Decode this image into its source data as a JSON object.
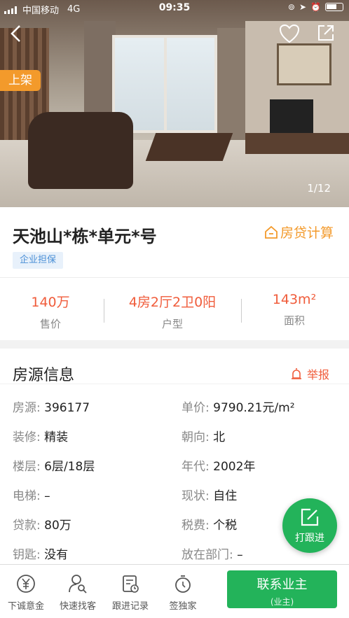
{
  "status_bar": {
    "carrier": "中国移动",
    "network": "4G",
    "time": "09:35"
  },
  "hero": {
    "listing_tag": "上架",
    "photo_counter": "1/12"
  },
  "title": {
    "name": "天池山*栋*单元*号",
    "mortgage_label": "房贷计算",
    "badge": "企业担保"
  },
  "stats": [
    {
      "value": "140万",
      "label": "售价"
    },
    {
      "value": "4房2厅2卫0阳",
      "label": "户型"
    },
    {
      "value": "143m²",
      "label": "面积"
    }
  ],
  "info": {
    "section_title": "房源信息",
    "report_label": "举报",
    "rows": [
      {
        "key": "房源:",
        "value": "396177"
      },
      {
        "key": "单价:",
        "value": "9790.21元/m²"
      },
      {
        "key": "装修:",
        "value": "精装"
      },
      {
        "key": "朝向:",
        "value": "北"
      },
      {
        "key": "楼层:",
        "value": "6层/18层"
      },
      {
        "key": "年代:",
        "value": "2002年"
      },
      {
        "key": "电梯:",
        "value": "–"
      },
      {
        "key": "现状:",
        "value": "自住"
      },
      {
        "key": "贷款:",
        "value": "80万"
      },
      {
        "key": "税费:",
        "value": "个税"
      },
      {
        "key": "钥匙:",
        "value": "没有"
      },
      {
        "key": "放在部门:",
        "value": "–"
      }
    ]
  },
  "fab": {
    "label": "打跟进"
  },
  "bottom_nav": [
    {
      "label": "下诚意金",
      "icon": "yen-coin-icon"
    },
    {
      "label": "快速找客",
      "icon": "person-search-icon"
    },
    {
      "label": "跟进记录",
      "icon": "record-icon"
    },
    {
      "label": "签独家",
      "icon": "stopwatch-icon"
    }
  ],
  "contact": {
    "main": "联系业主",
    "sub": "(业主)"
  },
  "colors": {
    "accent_green": "#23b35a",
    "orange": "#f39a2b",
    "red": "#f05c3b",
    "blue": "#4a8fd6"
  }
}
